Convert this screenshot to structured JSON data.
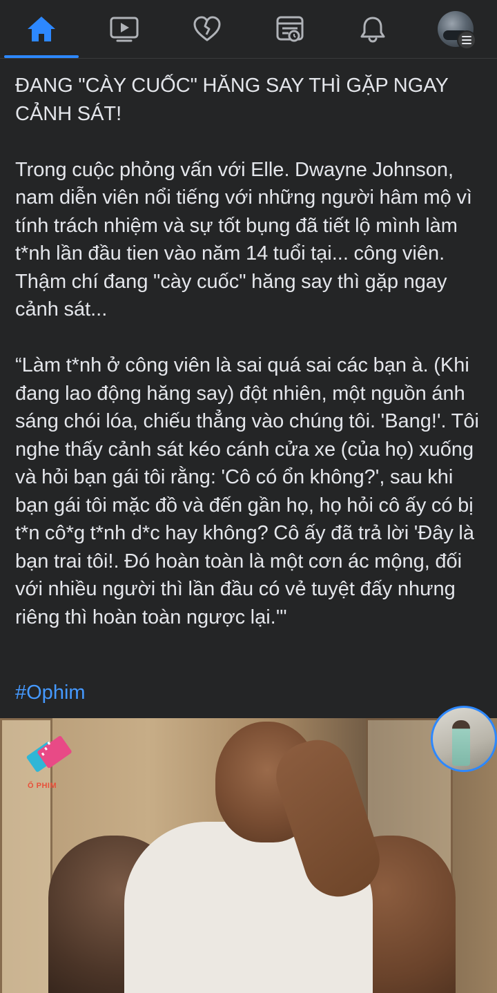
{
  "nav": {
    "tabs": [
      {
        "name": "home",
        "icon": "home-icon",
        "active": true
      },
      {
        "name": "watch",
        "icon": "video-play-icon",
        "active": false
      },
      {
        "name": "dating",
        "icon": "heart-icon",
        "active": false
      },
      {
        "name": "news",
        "icon": "news-feed-icon",
        "active": false
      },
      {
        "name": "notifications",
        "icon": "bell-icon",
        "active": false
      },
      {
        "name": "menu",
        "icon": "profile-avatar",
        "active": false
      }
    ],
    "active_color": "#2d88ff",
    "icon_color": "#b0b3b8"
  },
  "post": {
    "title": "ĐANG \"CÀY CUỐC\" HĂNG SAY THÌ GẶP NGAY CẢNH SÁT!",
    "paragraph_1": "Trong cuộc phỏng vấn với Elle. Dwayne Johnson, nam diễn viên nổi tiếng với những người hâm mộ vì tính trách nhiệm và sự tốt bụng đã tiết lộ mình làm t*nh lần đầu tien vào năm 14 tuổi tại... công viên. Thậm chí đang \"cày cuốc\" hăng say thì gặp ngay cảnh sát...",
    "paragraph_2": "“Làm t*nh ở công viên là sai quá sai các bạn à. (Khi đang lao động hăng say) đột nhiên, một nguồn ánh sáng chói lóa, chiếu thẳng vào chúng tôi. 'Bang!'. Tôi nghe thấy cảnh sát kéo cánh cửa xe (của họ) xuống và hỏi bạn gái tôi rằng: 'Cô có ổn không?', sau khi bạn gái tôi mặc đồ và đến gần họ, họ hỏi cô ấy có bị t*n cô*g t*nh d*c hay không? Cô ấy đã trả lời 'Đây là bạn trai tôi!. Đó hoàn toàn là một cơn ác mộng, đối với nhiều người thì lần đầu có vẻ tuyệt đấy nhưng riêng thì hoàn toàn ngược lại.'\"",
    "hashtag": "#Ophim",
    "hashtag_color": "#4599ff"
  },
  "photo": {
    "watermark_text": "Ổ PHIM"
  }
}
